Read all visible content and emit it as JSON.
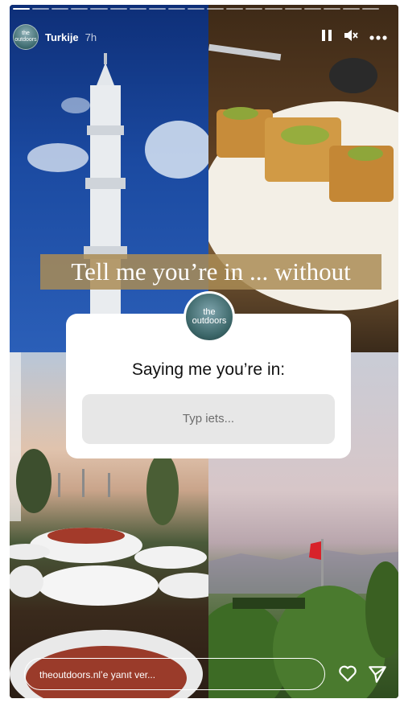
{
  "story": {
    "username": "Turkije",
    "time": "7h",
    "avatar_text": "the outdoors",
    "progress_segments": 19,
    "progress_done": 1
  },
  "controls": {
    "pause_icon": "pause-icon",
    "mute_icon": "mute-icon",
    "more_icon": "more-icon"
  },
  "overlay": {
    "banner_text": "Tell me you’re in ... without"
  },
  "question_sticker": {
    "avatar_text": "the outdoors",
    "question": "Saying me you’re in:",
    "placeholder": "Typ iets..."
  },
  "footer": {
    "reply_placeholder": "theoutdoors.nl’e yanıt ver...",
    "like_icon": "heart-icon",
    "share_icon": "send-icon"
  },
  "colors": {
    "banner_bg": "#aa8c55",
    "answer_bg": "#e7e7e7"
  }
}
